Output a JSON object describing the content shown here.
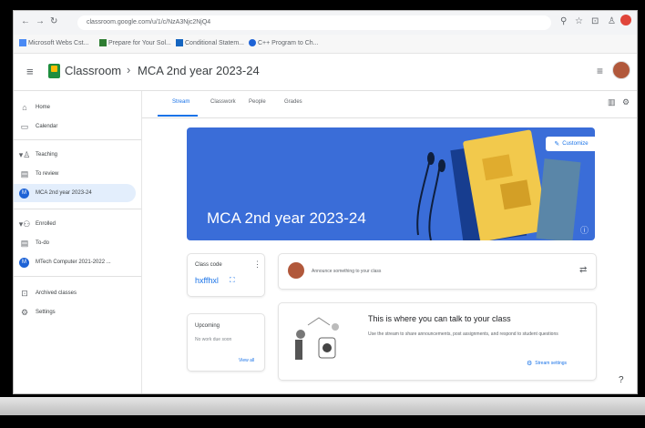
{
  "browser": {
    "url": "classroom.google.com/u/1/c/NzA3Njc2NjQ4",
    "bookmarks": [
      "Microsoft Webs Cst...",
      "Prepare for Your Sol...",
      "Conditional Statem...",
      "C++ Program to Ch..."
    ]
  },
  "header": {
    "app_name": "Classroom",
    "separator": "›",
    "class_name": "MCA 2nd year 2023-24"
  },
  "tabs": [
    "Stream",
    "Classwork",
    "People",
    "Grades"
  ],
  "sidebar": {
    "home": "Home",
    "calendar": "Calendar",
    "teaching": "Teaching",
    "to_review": "To review",
    "active_class": "MCA 2nd year 2023-24",
    "enrolled": "Enrolled",
    "todo": "To-do",
    "mtech_class": "MTech Computer 2021-2022 ...",
    "archived": "Archived classes",
    "settings": "Settings",
    "avatar_letter": "M"
  },
  "banner": {
    "title": "MCA 2nd year 2023-24",
    "customize": "Customize"
  },
  "class_code": {
    "label": "Class code",
    "code": "hxffhxl"
  },
  "upcoming": {
    "title": "Upcoming",
    "empty": "No work due soon",
    "view_all": "View all"
  },
  "announce": {
    "placeholder": "Announce something to your class"
  },
  "stream_info": {
    "heading": "This is where you can talk to your class",
    "body": "Use the stream to share announcements, post assignments, and respond to student questions",
    "settings": "Stream settings"
  },
  "colors": {
    "banner": "#3a6dd8",
    "accent": "#1a73e8",
    "active_bg": "#e3eefc"
  }
}
